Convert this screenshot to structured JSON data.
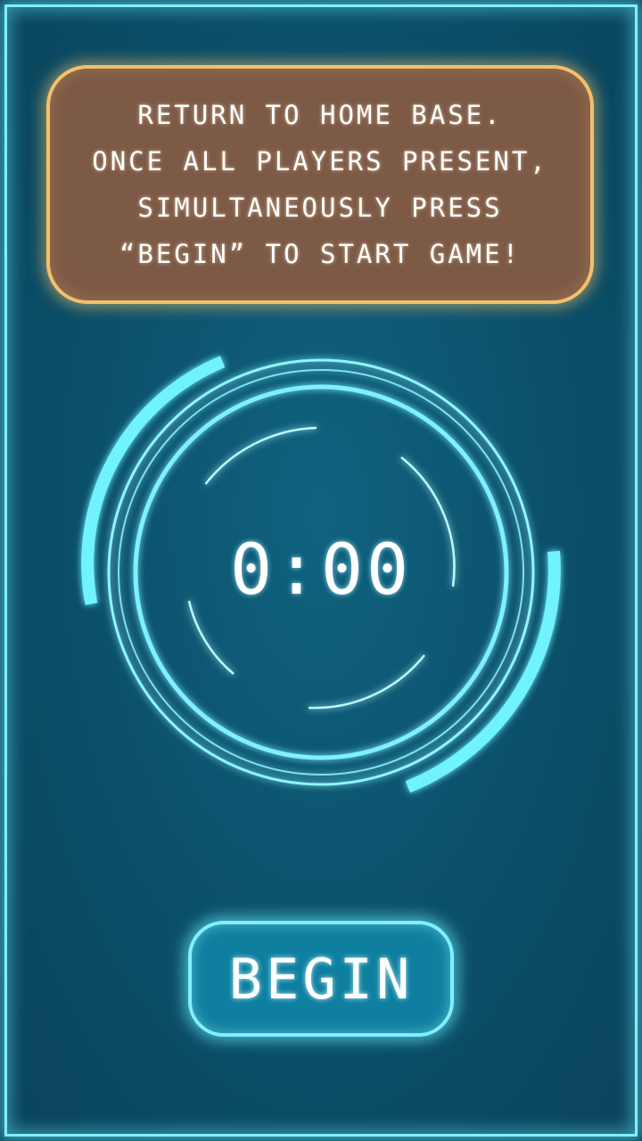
{
  "instructions": {
    "lines": [
      "Return to home base.",
      "Once all players present,",
      "simultaneously press",
      "“Begin” to start game!"
    ]
  },
  "timer": {
    "display": "0:00"
  },
  "begin_button": {
    "label": "BEGIN"
  },
  "colors": {
    "background": "#0b4f69",
    "glow_cyan": "#7ff0ff",
    "panel_brown": "#7d5a46",
    "panel_border": "#f3c06c",
    "button_fill": "#0f7fa0"
  }
}
